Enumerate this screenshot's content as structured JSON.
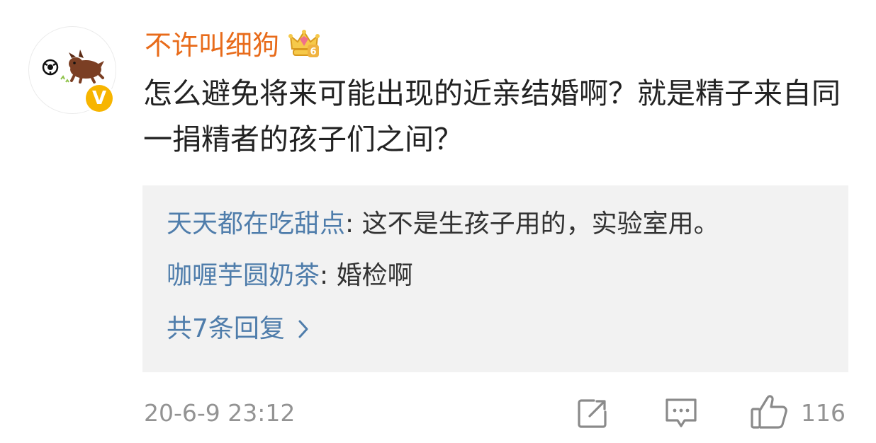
{
  "comment": {
    "username": "不许叫细狗",
    "verified_badge": "V",
    "vip_level": "6",
    "text": "怎么避免将来可能出现的近亲结婚啊？就是精子来自同一捐精者的孩子们之间？",
    "timestamp": "20-6-9 23:12",
    "like_count": "116"
  },
  "replies": [
    {
      "author": "天天都在吃甜点",
      "separator": ": ",
      "text": "这不是生孩子用的，实验室用。"
    },
    {
      "author": "咖喱芋圆奶茶",
      "separator": ": ",
      "text": "婚检啊"
    }
  ],
  "more_replies_label": "共7条回复",
  "icons": {
    "avatar": "dog-avatar",
    "crown": "vip-crown-icon",
    "chevron": "chevron-right-icon",
    "share": "share-edit-icon",
    "comment": "comment-icon",
    "like": "thumbs-up-icon"
  },
  "colors": {
    "username": "#e86b1a",
    "reply_author": "#4f7dab",
    "meta": "#939393",
    "badge": "#f7b500"
  }
}
